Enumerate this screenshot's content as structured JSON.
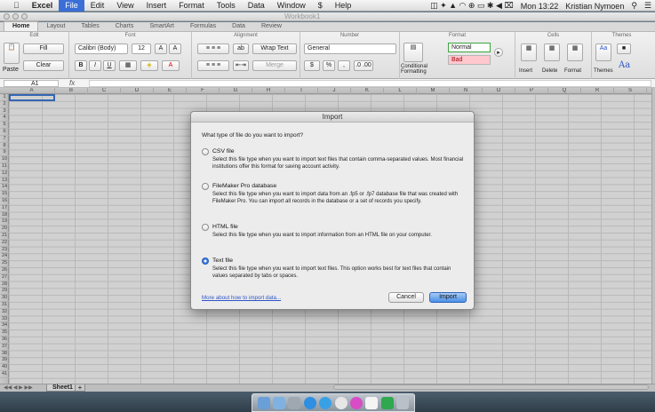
{
  "menubar": {
    "apple": "",
    "app": "Excel",
    "items": [
      "File",
      "Edit",
      "View",
      "Insert",
      "Format",
      "Tools",
      "Data",
      "Window",
      "Help"
    ],
    "script_icon": "$",
    "clock": "Mon 13:22",
    "user": "Kristian Nymoen"
  },
  "window": {
    "title": "Workbook1"
  },
  "ribbon": {
    "tabs": [
      "Home",
      "Layout",
      "Tables",
      "Charts",
      "SmartArt",
      "Formulas",
      "Data",
      "Review"
    ],
    "groups": {
      "edit": "Edit",
      "font": "Font",
      "alignment": "Alignment",
      "number": "Number",
      "format": "Format",
      "cells": "Cells",
      "themes": "Themes"
    },
    "fill": "Fill",
    "clear": "Clear",
    "paste": "Paste",
    "font_name": "Calibri (Body)",
    "font_size": "12",
    "bold": "B",
    "italic": "I",
    "underline": "U",
    "wrap_text": "Wrap Text",
    "merge": "Merge",
    "number_format": "General",
    "percent": "%",
    "comma": ",",
    "conditional_formatting": "Conditional Formatting",
    "style_normal": "Normal",
    "style_bad": "Bad",
    "insert": "Insert",
    "delete": "Delete",
    "format_btn": "Format",
    "themes_btn": "Themes",
    "aa": "Aa"
  },
  "formula": {
    "name_box": "A1",
    "fx": "fx",
    "value": ""
  },
  "columns": [
    "A",
    "B",
    "C",
    "D",
    "E",
    "F",
    "G",
    "H",
    "I",
    "J",
    "K",
    "L",
    "M",
    "N",
    "O",
    "P",
    "Q",
    "R",
    "S"
  ],
  "rows": [
    "1",
    "2",
    "3",
    "4",
    "5",
    "6",
    "7",
    "8",
    "9",
    "10",
    "11",
    "12",
    "13",
    "14",
    "15",
    "16",
    "17",
    "18",
    "19",
    "20",
    "21",
    "22",
    "23",
    "24",
    "25",
    "26",
    "27",
    "28",
    "29",
    "30",
    "31",
    "32",
    "33",
    "34",
    "35",
    "36",
    "37",
    "38",
    "39",
    "40",
    "41"
  ],
  "sheet_tab": "Sheet1",
  "add_sheet": "+",
  "dialog": {
    "title": "Import",
    "question": "What type of file do you want to import?",
    "options": [
      {
        "name": "CSV file",
        "desc": "Select this file type when you want to import text files that contain comma-separated values. Most financial institutions offer this format for saving account activity.",
        "selected": false
      },
      {
        "name": "FileMaker Pro database",
        "desc": "Select this file type when you want to import data from an .fp5 or .fp7 database file that was created with FileMaker Pro.  You can import all records in the database or a set of records you specify.",
        "selected": false
      },
      {
        "name": "HTML file",
        "desc": "Select this file type when you want to import information from an HTML file on your computer.",
        "selected": false
      },
      {
        "name": "Text file",
        "desc": "Select this file type when you want to import text files.  This option works best for text files that contain values separated by tabs or spaces.",
        "selected": true
      }
    ],
    "more_link": "More about how to import data...",
    "cancel": "Cancel",
    "import": "Import"
  },
  "colors": {
    "accent": "#3a7be0",
    "selection": "#3d7dd8",
    "style_normal_bg": "#ffffff",
    "style_normal_border": "#3aa53a",
    "style_bad_bg": "#ffc7ce",
    "style_bad_text": "#9c0006"
  }
}
